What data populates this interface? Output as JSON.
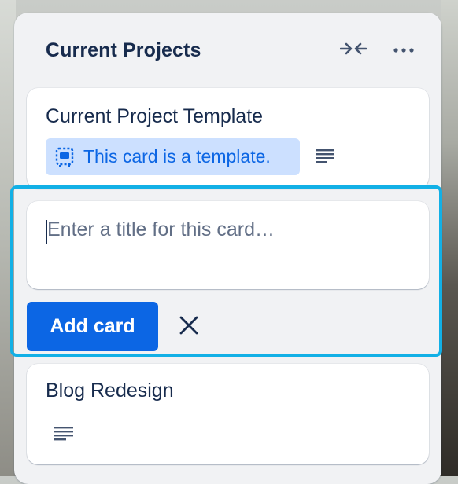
{
  "list": {
    "title": "Current Projects",
    "collapse_icon": "collapse-arrows-icon",
    "more_icon": "more-dots-icon"
  },
  "cards": [
    {
      "title": "Current Project Template",
      "badge": "This card is a template.",
      "badge_icon": "template-card-icon",
      "has_description": true
    },
    {
      "title": "Blog Redesign",
      "has_description": true
    }
  ],
  "composer": {
    "placeholder": "Enter a title for this card…",
    "add_label": "Add card",
    "cancel_icon": "close-icon"
  },
  "colors": {
    "accent": "#0c66e4",
    "focus_ring": "#12b0e6",
    "badge_bg": "#cce0ff",
    "text": "#172b4d",
    "list_bg": "#f1f2f4"
  }
}
